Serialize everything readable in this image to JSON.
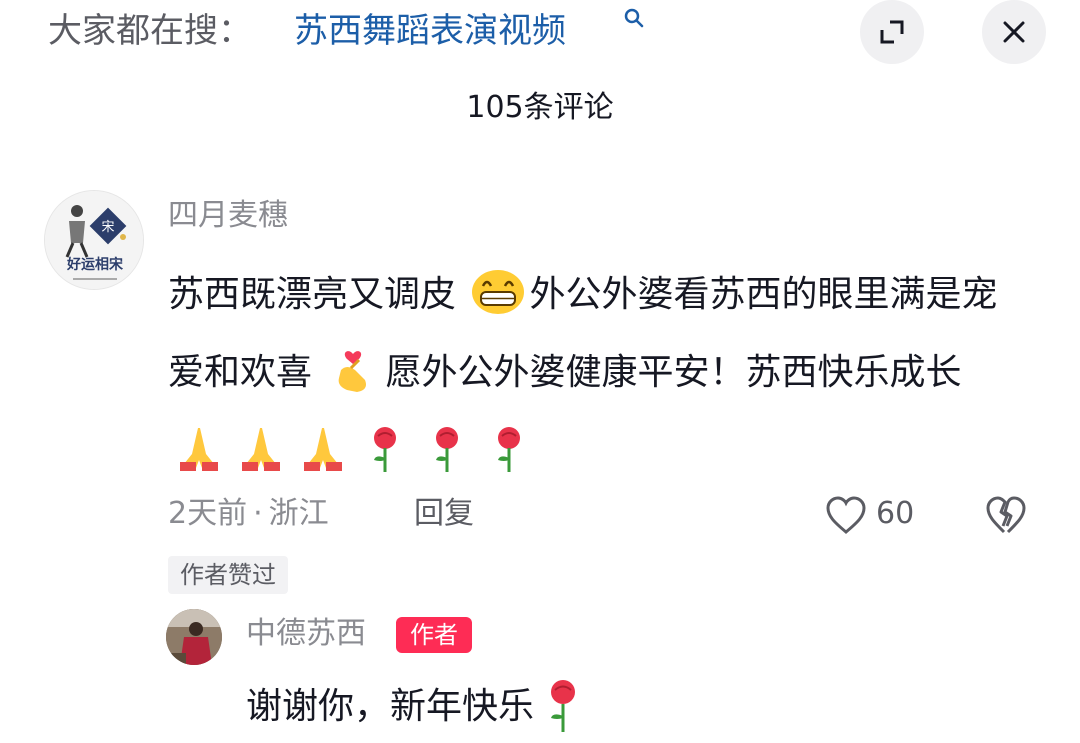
{
  "search_bar": {
    "prefix": "大家都在搜：",
    "term": "苏西舞蹈表演视频"
  },
  "header": {
    "comment_count": "105条评论"
  },
  "comments": [
    {
      "username": "四月麦穗",
      "text_parts": [
        "苏西既漂亮又调皮",
        "外公外婆看苏西的眼里满是宠爱和欢喜",
        "愿外公外婆健康平安！苏西快乐成长"
      ],
      "emojis": [
        "grinning-face-icon",
        "heart-hands-icon",
        "folded-hands-icon",
        "rose-icon"
      ],
      "time": "2天前",
      "location": "浙江",
      "reply_label": "回复",
      "likes": "60",
      "liked_by_author_label": "作者赞过",
      "avatar_text": "好运相宋",
      "replies": [
        {
          "username": "中德苏西",
          "badge": "作者",
          "text": "谢谢你，新年快乐"
        }
      ]
    }
  ]
}
